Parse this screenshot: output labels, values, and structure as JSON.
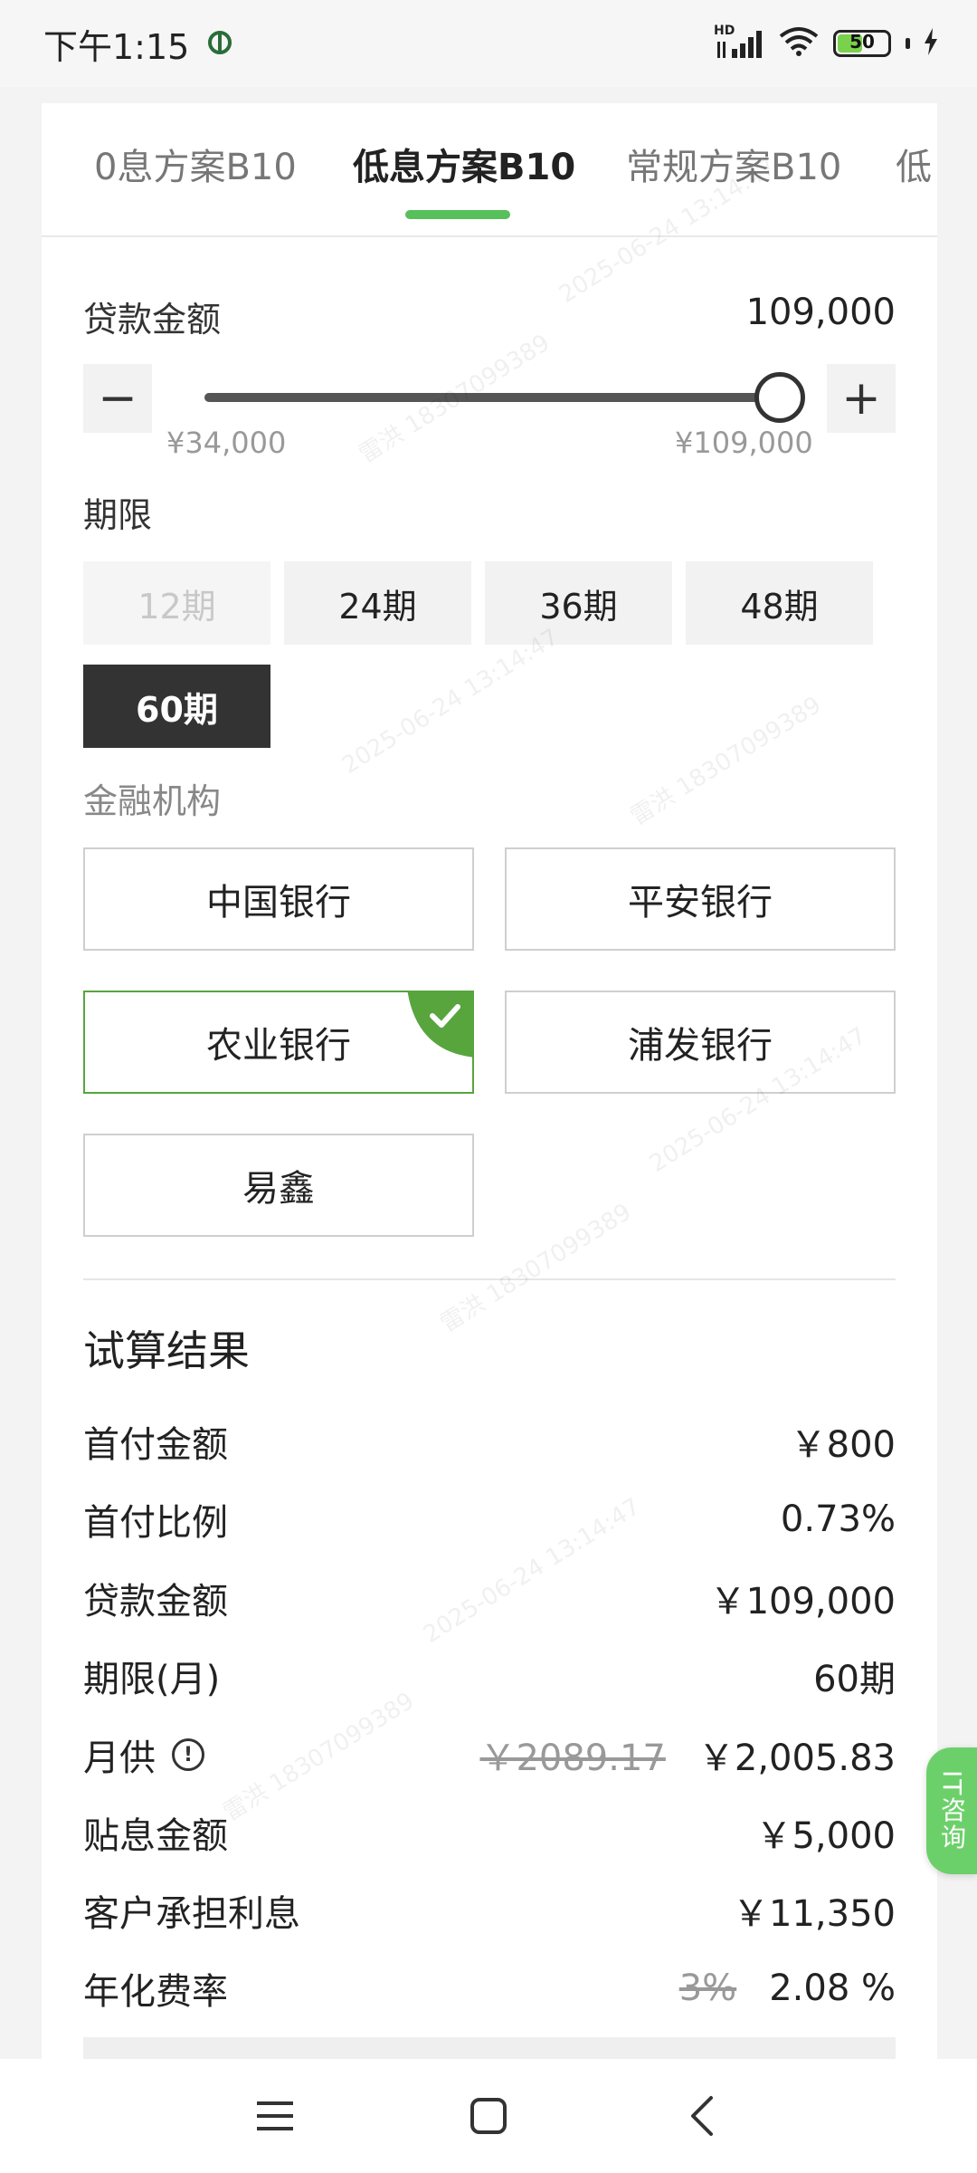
{
  "status_bar": {
    "time": "下午1:15",
    "network_label": "HD",
    "battery_level": "50"
  },
  "tabs": [
    {
      "label": "0息方案B10",
      "active": false
    },
    {
      "label": "低息方案B10",
      "active": true
    },
    {
      "label": "常规方案B10",
      "active": false
    },
    {
      "label": "低",
      "active": false
    }
  ],
  "loan": {
    "label": "贷款金额",
    "value": "109,000",
    "min_label": "¥34,000",
    "max_label": "¥109,000",
    "slider_fraction": 1.0,
    "minus": "−",
    "plus": "+"
  },
  "period": {
    "label": "期限",
    "options": [
      {
        "label": "12期",
        "state": "disabled"
      },
      {
        "label": "24期",
        "state": "normal"
      },
      {
        "label": "36期",
        "state": "normal"
      },
      {
        "label": "48期",
        "state": "normal"
      },
      {
        "label": "60期",
        "state": "selected"
      }
    ]
  },
  "institution": {
    "label": "金融机构",
    "banks": [
      {
        "label": "中国银行",
        "selected": false
      },
      {
        "label": "平安银行",
        "selected": false
      },
      {
        "label": "农业银行",
        "selected": true
      },
      {
        "label": "浦发银行",
        "selected": false
      },
      {
        "label": "易鑫",
        "selected": false
      }
    ]
  },
  "result": {
    "title": "试算结果",
    "rows": [
      {
        "label": "首付金额",
        "value": "￥800"
      },
      {
        "label": "首付比例",
        "value": "0.73%"
      },
      {
        "label": "贷款金额",
        "value": "￥109,000"
      },
      {
        "label": "期限(月)",
        "value": "60期"
      },
      {
        "label": "月供",
        "original": "￥2089.17",
        "value": "￥2,005.83"
      },
      {
        "label": "贴息金额",
        "value": "￥5,000"
      },
      {
        "label": "客户承担利息",
        "value": "￥11,350"
      },
      {
        "label": "年化费率",
        "original": "3%",
        "value": "2.08 %"
      }
    ]
  },
  "float_button": {
    "label": "IT咨询"
  },
  "watermark": {
    "name": "雷洪",
    "phone": "18307099389",
    "datetime": "2025-06-24 13:14:47"
  },
  "colors": {
    "accent": "#58c05a",
    "selected_dark": "#333333",
    "check_green": "#58a53e"
  },
  "icons": {
    "info": "info-circle-icon",
    "check": "check-icon",
    "menu": "menu-icon",
    "home": "home-square-icon",
    "back": "back-chevron-icon"
  }
}
